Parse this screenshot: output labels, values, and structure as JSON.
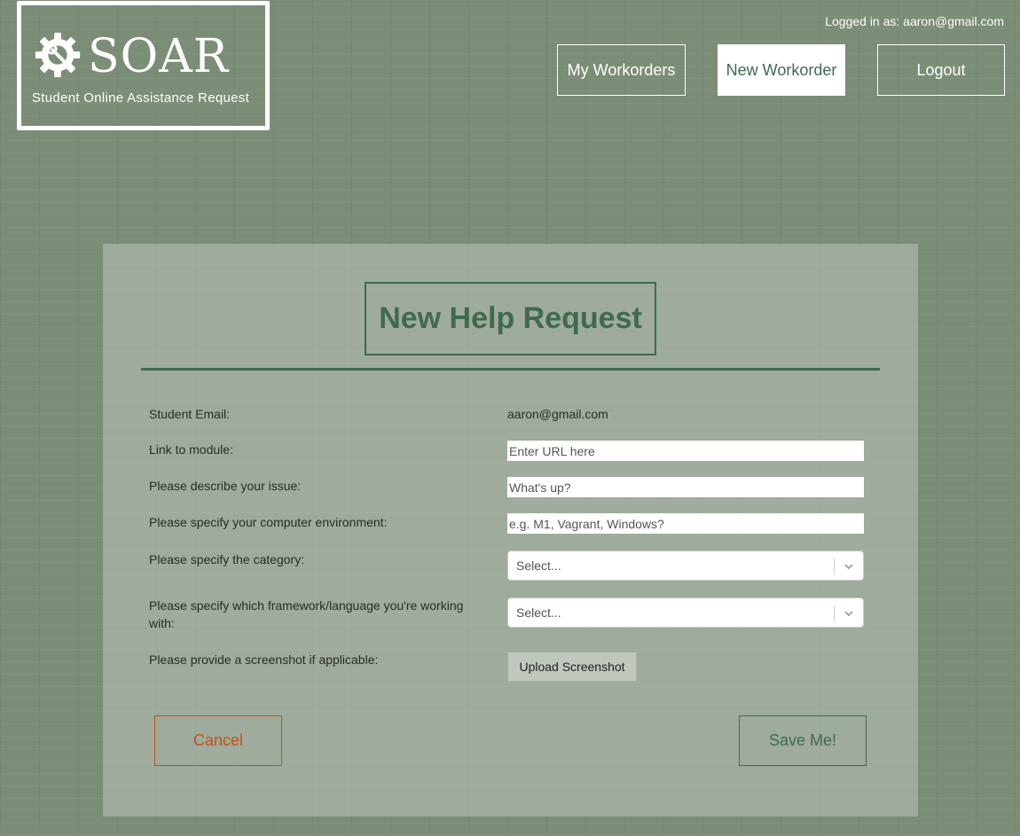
{
  "logo": {
    "wordmark": "SOAR",
    "tagline": "Student Online Assistance Request",
    "icon": "gear-wrench-icon"
  },
  "header": {
    "logged_in_text": "Logged in as: aaron@gmail.com",
    "nav": {
      "my_workorders": "My Workorders",
      "new_workorder": "New Workorder",
      "logout": "Logout"
    }
  },
  "form": {
    "title": "New Help Request",
    "fields": {
      "student_email": {
        "label": "Student Email:",
        "value": "aaron@gmail.com"
      },
      "module_link": {
        "label": "Link to module:",
        "placeholder": "Enter URL here"
      },
      "issue": {
        "label": "Please describe your issue:",
        "placeholder": "What's up?"
      },
      "environment": {
        "label": "Please specify your computer environment:",
        "placeholder": "e.g. M1, Vagrant, Windows?"
      },
      "category": {
        "label": "Please specify the category:",
        "selected": "Select..."
      },
      "framework": {
        "label": "Please specify which framework/language you're working with:",
        "selected": "Select..."
      },
      "screenshot": {
        "label": "Please provide a screenshot if applicable:",
        "button": "Upload Screenshot"
      }
    },
    "cancel_label": "Cancel",
    "save_label": "Save Me!"
  },
  "colors": {
    "background": "#7b8d76",
    "accent_green": "#3f6a52",
    "cancel_orange": "#c0521a",
    "white": "#ffffff"
  }
}
